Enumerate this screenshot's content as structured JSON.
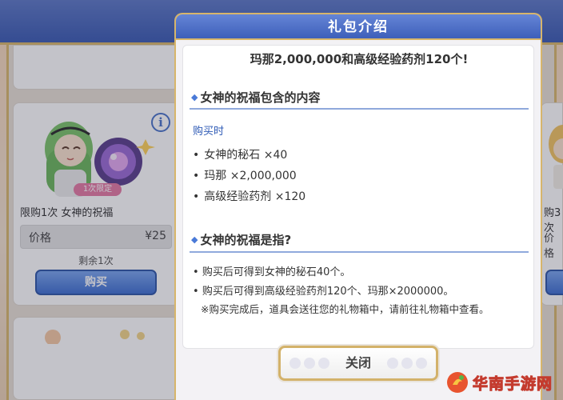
{
  "background": {
    "card": {
      "badge": "1次限定",
      "title": "限购1次 女神的祝福",
      "price_label": "价格",
      "price_value": "¥25",
      "remaining": "剩余1次",
      "buy_label": "购买"
    },
    "right_card": {
      "title_snippet": "购3次",
      "price_snippet": "价格"
    }
  },
  "modal": {
    "title": "礼包介绍",
    "headline": "玛那2,000,000和高级经验药剂120个!",
    "section1_title": "女神的祝福包含的内容",
    "purchase_label": "购买时",
    "items": [
      "女神的秘石 ×40",
      "玛那 ×2,000,000",
      "高级经验药剂 ×120"
    ],
    "section2_title": "女神的祝福是指?",
    "descriptions": [
      "购买后可得到女神的秘石40个。",
      "购买后可得到高级经验药剂120个、玛那×2000000。"
    ],
    "note": "※购买完成后，道具会送往您的礼物箱中，请前往礼物箱中查看。",
    "close_label": "关闭",
    "bullet": "•",
    "diamond": "◆"
  },
  "watermark": {
    "text": "华南手游网"
  },
  "colors": {
    "header_blue": "#3d5fba",
    "gold_border": "#d7b56b",
    "accent_blue": "#4a7ad8",
    "badge_pink": "#e57aa4"
  }
}
